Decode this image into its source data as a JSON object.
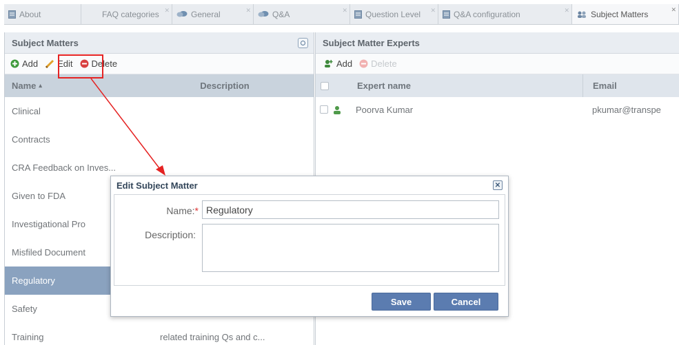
{
  "tabs": [
    {
      "label": "About",
      "icon": "document-icon",
      "active": false
    },
    {
      "label": "FAQ categories",
      "icon": "none",
      "active": false
    },
    {
      "label": "General",
      "icon": "speech-bubble-icon",
      "active": false
    },
    {
      "label": "Q&A",
      "icon": "speech-bubble-icon",
      "active": false
    },
    {
      "label": "Question Level",
      "icon": "document-icon",
      "active": false
    },
    {
      "label": "Q&A configuration",
      "icon": "document-icon",
      "active": false
    },
    {
      "label": "Subject Matters",
      "icon": "users-icon",
      "active": true
    }
  ],
  "left_panel": {
    "title": "Subject Matters",
    "toolbar": {
      "add": "Add",
      "edit": "Edit",
      "delete": "Delete"
    },
    "columns": {
      "name": "Name",
      "sort_indicator": "▴",
      "description": "Description"
    },
    "rows": [
      {
        "name": "Clinical",
        "description": ""
      },
      {
        "name": "Contracts",
        "description": ""
      },
      {
        "name": "CRA Feedback on Inves...",
        "description": ""
      },
      {
        "name": "Given to FDA",
        "description": ""
      },
      {
        "name": "Investigational Pro",
        "description": ""
      },
      {
        "name": "Misfiled Document",
        "description": ""
      },
      {
        "name": "Regulatory",
        "description": "",
        "selected": true
      },
      {
        "name": "Safety",
        "description": ""
      },
      {
        "name": "Training",
        "description": "related training Qs and c..."
      }
    ]
  },
  "right_panel": {
    "title": "Subject Matter Experts",
    "toolbar": {
      "add": "Add",
      "delete": "Delete"
    },
    "columns": {
      "expert_name": "Expert name",
      "email": "Email"
    },
    "rows": [
      {
        "name": "Poorva Kumar",
        "email": "pkumar@transpe"
      }
    ]
  },
  "dialog": {
    "title": "Edit Subject Matter",
    "name_label": "Name:",
    "required_mark": "*",
    "name_value": "Regulatory",
    "description_label": "Description:",
    "description_value": "",
    "save": "Save",
    "cancel": "Cancel"
  },
  "colors": {
    "selected_row": "#8aa2bf",
    "highlight": "#e52222",
    "add_green": "#3f9a3c",
    "delete_red": "#d84040",
    "button_blue": "#5b7cb0"
  }
}
